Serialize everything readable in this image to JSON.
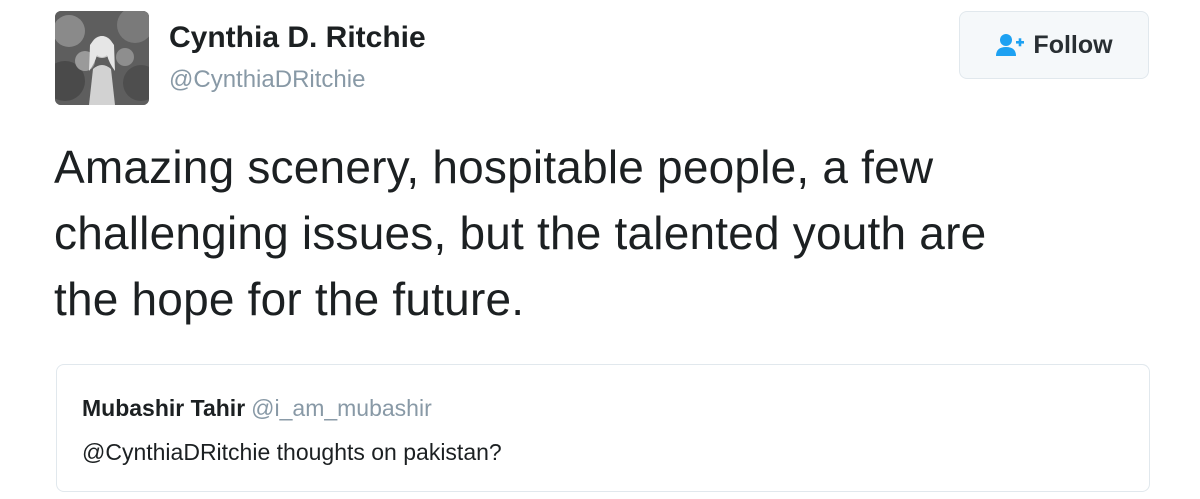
{
  "author": {
    "display_name": "Cynthia D. Ritchie",
    "handle": "@CynthiaDRitchie",
    "avatar_icon": "profile-photo"
  },
  "follow_button": {
    "label": "Follow",
    "icon": "add-user-icon",
    "icon_color": "#1da1f2"
  },
  "tweet": {
    "text_lines": [
      "Amazing scenery, hospitable people, a few",
      "challenging issues, but the talented youth are",
      "the hope for the future."
    ]
  },
  "quoted_tweet": {
    "author_name": "Mubashir Tahir",
    "author_handle": "@i_am_mubashir",
    "text": "@CynthiaDRitchie thoughts on pakistan?"
  }
}
